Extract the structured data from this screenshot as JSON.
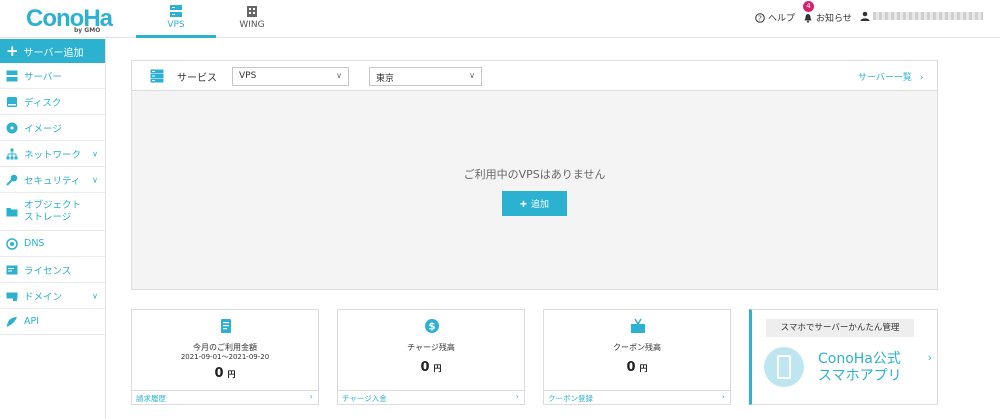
{
  "header": {
    "logo": "ConoHa",
    "logo_sub": "by GMO",
    "tabs": [
      {
        "label": "VPS",
        "active": true
      },
      {
        "label": "WING",
        "active": false
      }
    ],
    "help": "ヘルプ",
    "notice": "お知らせ",
    "notice_count": "4"
  },
  "sidebar": {
    "add_label": "サーバー追加",
    "items": [
      {
        "label": "サーバー",
        "icon": "server-icon"
      },
      {
        "label": "ディスク",
        "icon": "disk-icon"
      },
      {
        "label": "イメージ",
        "icon": "image-icon"
      },
      {
        "label": "ネットワーク",
        "icon": "network-icon"
      },
      {
        "label": "セキュリティ",
        "icon": "key-icon"
      },
      {
        "label": "オブジェクト",
        "label2": "ストレージ",
        "icon": "folder-icon"
      },
      {
        "label": "DNS",
        "icon": "dns-icon"
      },
      {
        "label": "ライセンス",
        "icon": "license-icon"
      },
      {
        "label": "ドメイン",
        "icon": "domain-icon"
      },
      {
        "label": "API",
        "icon": "api-icon"
      }
    ]
  },
  "service": {
    "label": "サービス",
    "type_value": "VPS",
    "region_value": "東京",
    "list_link": "サーバー一覧",
    "empty_message": "ご利用中のVPSはありません",
    "add_button": "追加"
  },
  "cards": [
    {
      "title": "今月のご利用金額",
      "period": "2021-09-01～2021-09-20",
      "amount": "0",
      "unit": "円",
      "link": "請求履歴"
    },
    {
      "title": "チャージ残高",
      "amount": "0",
      "unit": "円",
      "link": "チャージ入金"
    },
    {
      "title": "クーポン残高",
      "amount": "0",
      "unit": "円",
      "link": "クーポン登録"
    }
  ],
  "promo": {
    "title": "スマホでサーバーかんたん管理",
    "line1": "ConoHa公式",
    "line2": "スマホアプリ"
  },
  "colors": {
    "accent": "#2cb2d0",
    "badge": "#d6226c"
  }
}
